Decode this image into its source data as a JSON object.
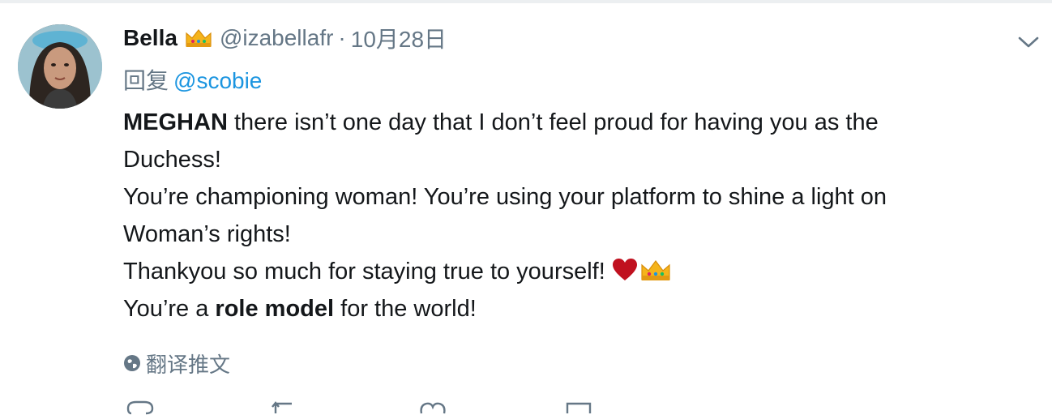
{
  "tweet": {
    "display_name": "Bella",
    "name_emoji": "crown-icon",
    "handle": "@izabellafr",
    "separator": "·",
    "time": "10月28日",
    "reply_prefix": "回复",
    "reply_to": "@scobie",
    "lines": [
      {
        "bold": "MEGHAN",
        "rest": " there isn’t one day that I don’t feel proud for having you as the"
      },
      {
        "text": "Duchess!"
      },
      {
        "text": "You’re championing woman! You’re using your platform to shine a light on"
      },
      {
        "text": "Woman’s rights!"
      },
      {
        "text": "Thankyou so much for staying true to yourself!"
      },
      {
        "pre": "You’re a ",
        "bold": "role model",
        "post": " for the world!"
      }
    ],
    "translate_label": "翻译推文"
  },
  "colors": {
    "text": "#14171a",
    "secondary": "#657786",
    "link": "#1b95e0",
    "heart": "#c0111f",
    "crown": "#f5b41b"
  }
}
